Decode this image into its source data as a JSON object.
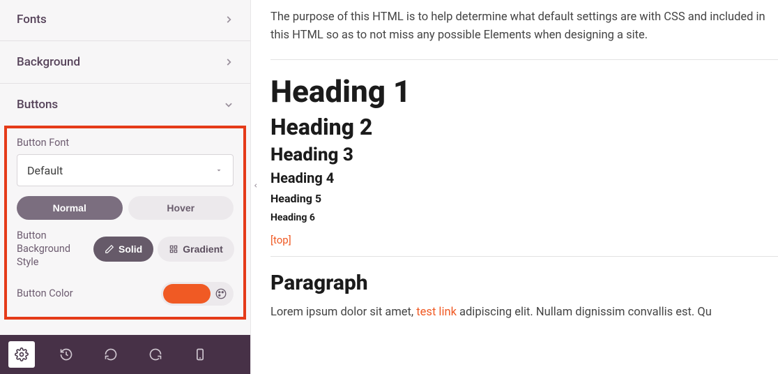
{
  "sidebar": {
    "sections": {
      "fonts": {
        "label": "Fonts"
      },
      "background": {
        "label": "Background"
      },
      "buttons": {
        "label": "Buttons"
      }
    },
    "buttons_panel": {
      "font_label": "Button Font",
      "font_value": "Default",
      "tabs": {
        "normal": "Normal",
        "hover": "Hover"
      },
      "bg_style_label": "Button Background Style",
      "bg_style_options": {
        "solid": "Solid",
        "gradient": "Gradient"
      },
      "color_label": "Button Color",
      "color_value": "#f05a24"
    }
  },
  "bottombar": {
    "items": [
      "settings",
      "history",
      "undo",
      "redo",
      "mobile"
    ]
  },
  "preview": {
    "intro": "The purpose of this HTML is to help determine what default settings are with CSS and included in this HTML so as to not miss any possible Elements when designing a site.",
    "h1": "Heading 1",
    "h2": "Heading 2",
    "h3": "Heading 3",
    "h4": "Heading 4",
    "h5": "Heading 5",
    "h6": "Heading 6",
    "top_link": "[top]",
    "para_head": "Paragraph",
    "para_prefix": "Lorem ipsum dolor sit amet, ",
    "para_link": "test link",
    "para_suffix": " adipiscing elit. Nullam dignissim convallis est. Qu"
  }
}
